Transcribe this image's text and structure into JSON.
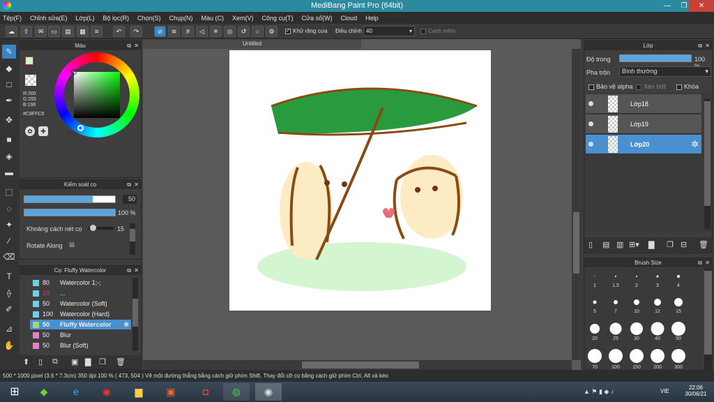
{
  "window": {
    "title": "MediBang Paint Pro (64bit)",
    "minimize": "—",
    "restore": "❐",
    "close": "✕"
  },
  "menu": [
    "Tệp(F)",
    "Chỉnh sửa(E)",
    "Lớp(L)",
    "Bộ lọc(R)",
    "Chọn(S)",
    "Chụp(N)",
    "Màu (C)",
    "Xem(V)",
    "Công cụ(T)",
    "Cửa số(W)",
    "Cloud",
    "Help"
  ],
  "toolbar": {
    "antialias_label": "Khử răng cưa",
    "adjust_label": "Điều chỉnh",
    "adjust_value": "40",
    "warning_label": "Canh mềm"
  },
  "color_panel": {
    "title": "Màu",
    "r": "R:200",
    "g": "G:255",
    "b": "B:198",
    "hex": "#C8FFC6"
  },
  "brush_control": {
    "title": "Kiểm soát cọ",
    "size_value": "50",
    "opacity_value": "100 %",
    "spacing_label": "Khoảng cách nét cọ",
    "spacing_value": "15",
    "rotate_label": "Rotate Along",
    "rotate_check": "☒"
  },
  "brush_list": {
    "title": "Cọ: Fluffy Watercolor",
    "items": [
      {
        "num": "80",
        "name": "Watercolor 1;-;",
        "color": "#6ad0f0"
      },
      {
        "num": "10",
        "name": "...",
        "color": "#6ad0f0"
      },
      {
        "num": "50",
        "name": "Watercolor (Soft)",
        "color": "#6ad0f0"
      },
      {
        "num": "100",
        "name": "Watercolor (Hard)",
        "color": "#6ad0f0"
      },
      {
        "num": "50",
        "name": "Fluffy Watercolor",
        "color": "#a0d870"
      },
      {
        "num": "50",
        "name": "Blur",
        "color": "#f07ad0"
      },
      {
        "num": "50",
        "name": "Blur (Soft)",
        "color": "#f07ad0"
      }
    ]
  },
  "canvas": {
    "tab_title": "Untitled"
  },
  "layers_panel": {
    "title": "Lớp",
    "opacity_label": "Độ trong",
    "opacity_value": "100 %",
    "blend_label": "Pha trộn",
    "blend_value": "Bình thường",
    "protect_alpha": "Bảo vệ alpha",
    "clipping": "Xén bớt",
    "lock": "Khóa",
    "layers": [
      {
        "name": "Lớp18",
        "selected": false
      },
      {
        "name": "Lớp19",
        "selected": false
      },
      {
        "name": "Lớp20",
        "selected": true
      }
    ]
  },
  "brush_size_panel": {
    "title": "Brush Size",
    "sizes": [
      "1",
      "1.5",
      "2",
      "3",
      "4",
      "5",
      "7",
      "10",
      "12",
      "15",
      "20",
      "25",
      "30",
      "40",
      "50",
      "70",
      "100",
      "150",
      "200",
      "300"
    ]
  },
  "status": {
    "text": "500 * 1000 pixel   (3.6 * 7.3cm)   350 dpi   100 %   ( 473, 504 )   Vẽ một đường thẳng bằng cách giữ phím Shift, Thay đổi cỡ cọ bằng cách giữ phím Ctrl, Alt và kéo"
  },
  "taskbar": {
    "lang": "VIE",
    "time": "22:06",
    "date": "30/06/21"
  }
}
